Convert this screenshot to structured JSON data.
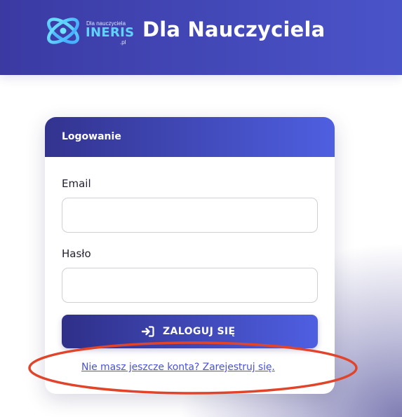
{
  "header": {
    "logo": {
      "small_text": "Dla nauczyciela",
      "brand": "INERIS",
      "domain": ".pl",
      "icon": "atom-logo-icon"
    },
    "title": "Dla Nauczyciela",
    "background_color": "#4048b8"
  },
  "login_card": {
    "title": "Logowanie",
    "email_label": "Email",
    "email_value": "",
    "email_placeholder": "",
    "password_label": "Hasło",
    "password_value": "",
    "password_placeholder": "",
    "submit_label": "ZALOGUJ SIĘ",
    "submit_icon": "sign-in-icon",
    "register_link": "Nie masz jeszcze konta? Zarejestruj się."
  },
  "colors": {
    "accent": "#4e5fe0",
    "accent_dark": "#2f2f88",
    "link": "#4a52d9",
    "annotation": "#e0452b"
  }
}
